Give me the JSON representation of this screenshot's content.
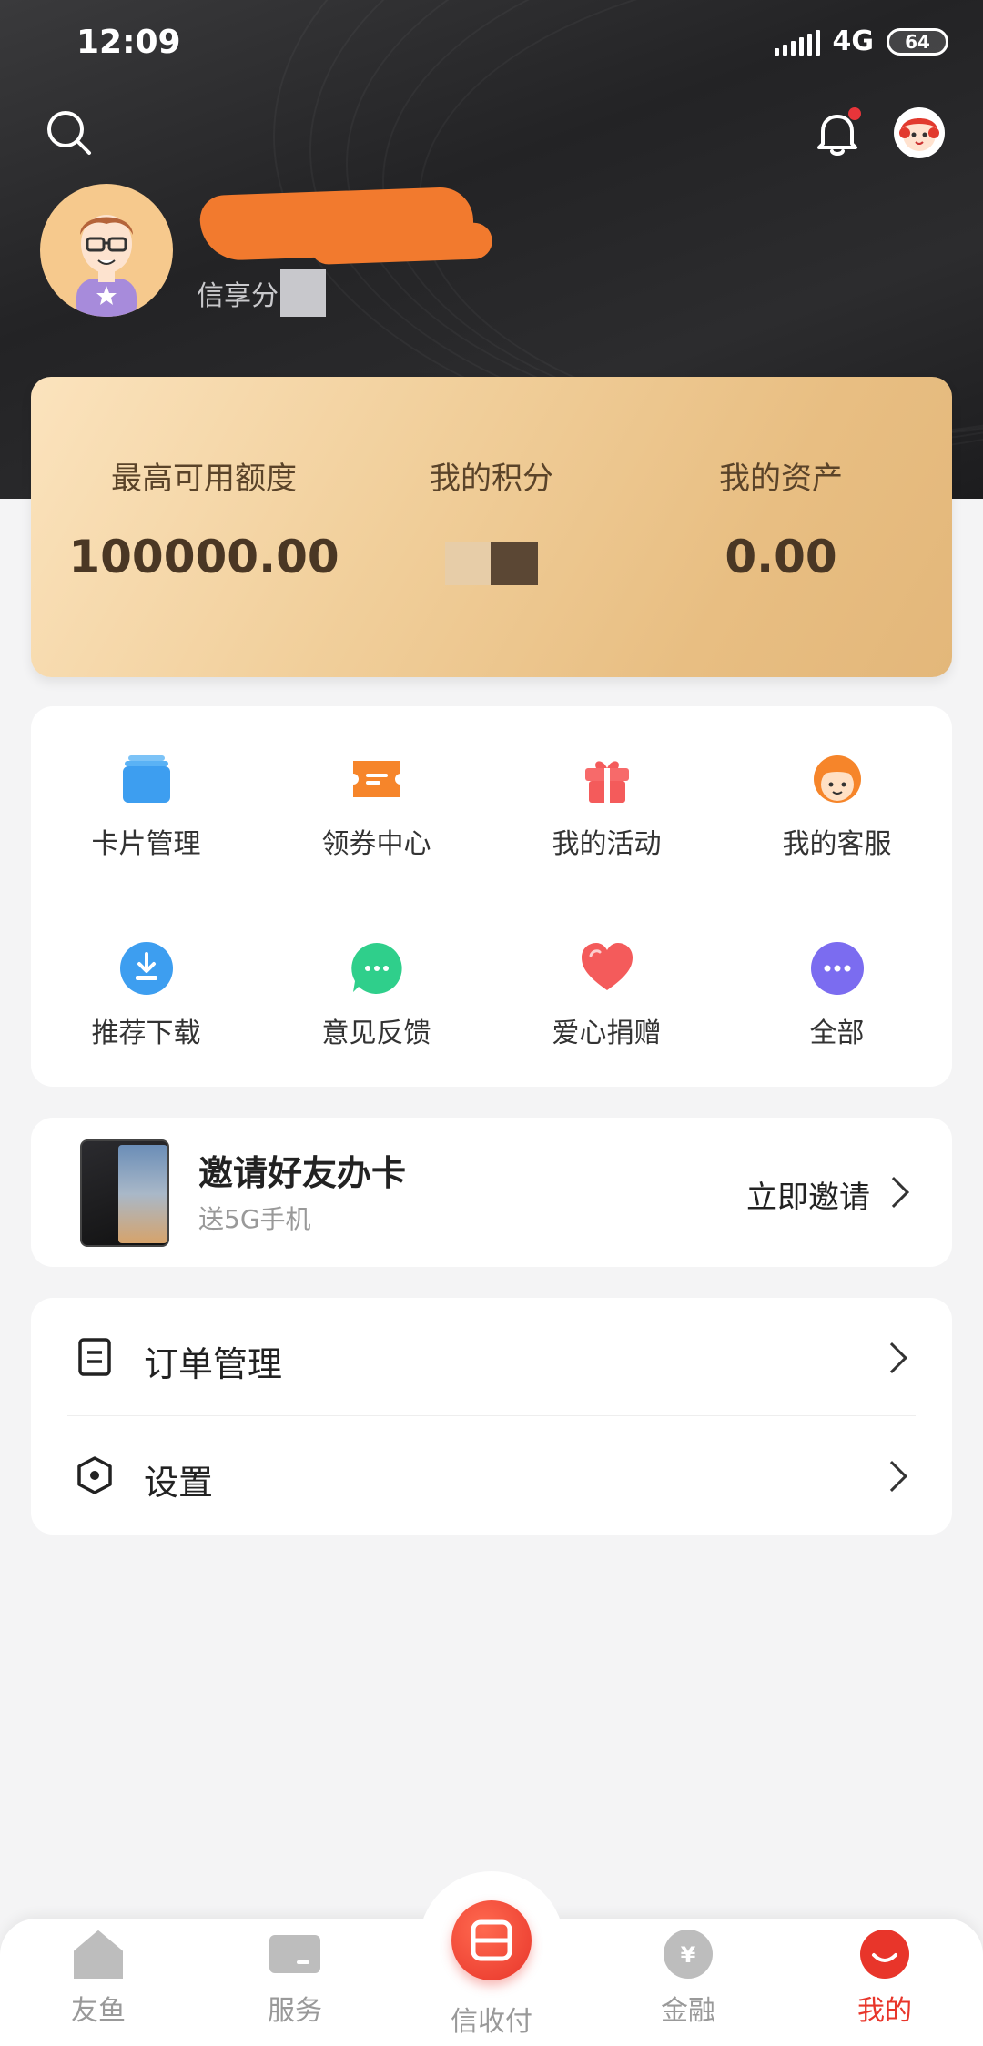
{
  "status_bar": {
    "time": "12:09",
    "network": "4G",
    "battery": "64"
  },
  "profile": {
    "credit_label": "信享分"
  },
  "stats": {
    "max_credit_label": "最高可用额度",
    "max_credit_value": "100000.00",
    "points_label": "我的积分",
    "assets_label": "我的资产",
    "assets_value": "0.00"
  },
  "grid": [
    {
      "label": "卡片管理",
      "icon": "card-icon"
    },
    {
      "label": "领券中心",
      "icon": "coupon-icon"
    },
    {
      "label": "我的活动",
      "icon": "gift-icon"
    },
    {
      "label": "我的客服",
      "icon": "service-icon"
    },
    {
      "label": "推荐下载",
      "icon": "download-icon"
    },
    {
      "label": "意见反馈",
      "icon": "feedback-icon"
    },
    {
      "label": "爱心捐赠",
      "icon": "heart-icon"
    },
    {
      "label": "全部",
      "icon": "more-icon"
    }
  ],
  "invite": {
    "title": "邀请好友办卡",
    "subtitle": "送5G手机",
    "action": "立即邀请"
  },
  "menu": {
    "orders": "订单管理",
    "settings": "设置"
  },
  "bottom_nav": {
    "home": "友鱼",
    "service": "服务",
    "pay": "信收付",
    "finance": "金融",
    "mine": "我的"
  },
  "colors": {
    "accent_red": "#e8352a",
    "active_tab": "#e8352a",
    "card_gold": "#f1cf9b"
  }
}
